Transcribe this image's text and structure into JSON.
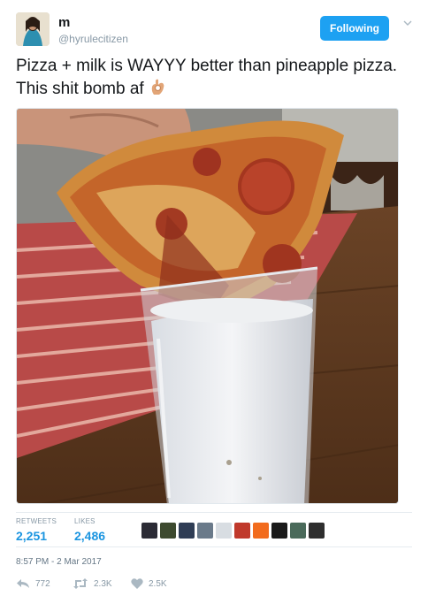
{
  "user": {
    "display_name": "m",
    "handle": "@hyrulecitizen",
    "follow_label": "Following"
  },
  "tweet": {
    "text": "Pizza + milk is WAYYY better than pineapple pizza. This shit bomb af",
    "emoji": "ok-hand-emoji"
  },
  "stats": {
    "retweets_label": "RETWEETS",
    "retweets_value": "2,251",
    "likes_label": "LIKES",
    "likes_value": "2,486"
  },
  "likers": {
    "colors": [
      "#2b2b35",
      "#3d4a2f",
      "#2f3d55",
      "#6a7a8a",
      "#d8dde2",
      "#c0392b",
      "#f26b1d",
      "#1a1a1a",
      "#4a6a5a",
      "#2e2e2e"
    ]
  },
  "timestamp": "8:57 PM - 2 Mar 2017",
  "actions": {
    "reply_count": "772",
    "retweet_count": "2.3K",
    "like_count": "2.5K"
  },
  "colors": {
    "accent": "#1da1f2",
    "link_blue": "#1b95e0",
    "muted": "#8899a6"
  }
}
